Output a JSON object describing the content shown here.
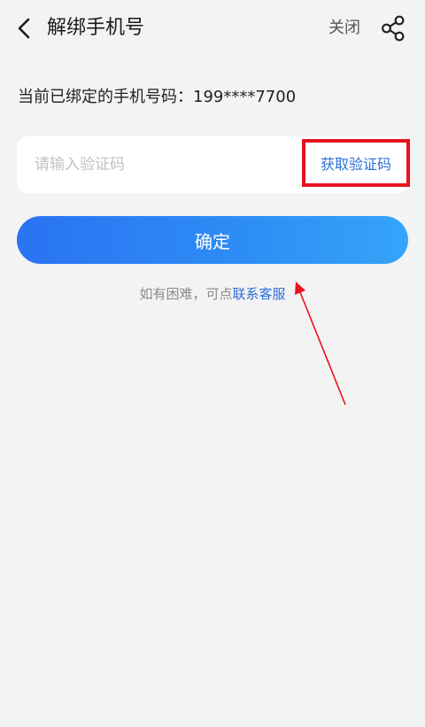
{
  "header": {
    "title": "解绑手机号",
    "close_label": "关闭"
  },
  "bound_phone": {
    "label": "当前已绑定的手机号码：199****7700"
  },
  "verification": {
    "placeholder": "请输入验证码",
    "get_code_label": "获取验证码"
  },
  "confirm_label": "确定",
  "help": {
    "prefix": "如有困难，可点",
    "link_label": "联系客服"
  },
  "icons": {
    "back": "chevron-left-icon",
    "share": "share-icon"
  },
  "colors": {
    "background": "#f3f3f4",
    "link_blue": "#2b6fd8",
    "button_gradient_start": "#2a73f1",
    "button_gradient_end": "#35a4f8",
    "annotation_red": "#e8121e"
  }
}
